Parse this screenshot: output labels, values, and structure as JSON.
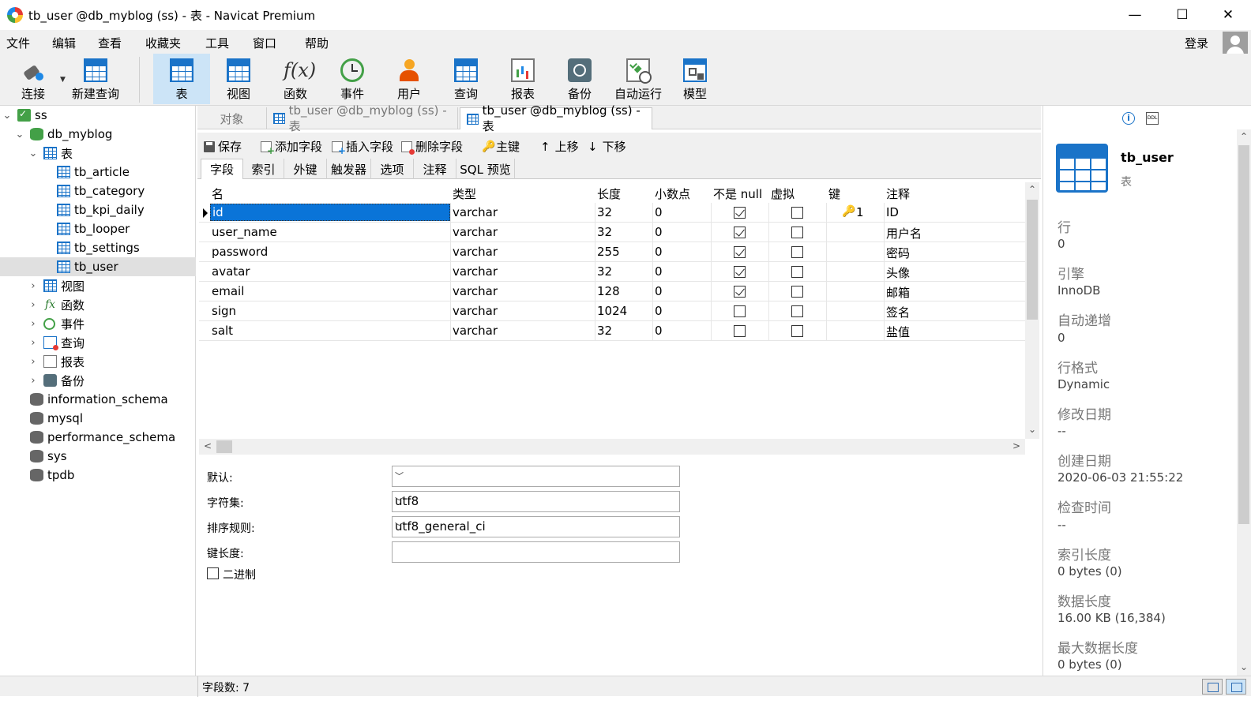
{
  "window": {
    "title": "tb_user @db_myblog (ss) - 表 - Navicat Premium",
    "minimize": "—",
    "maximize": "☐",
    "close": "✕"
  },
  "menu": [
    "文件",
    "编辑",
    "查看",
    "收藏夹",
    "工具",
    "窗口",
    "帮助"
  ],
  "login_label": "登录",
  "toolbar": {
    "connect": "连接",
    "new_query": "新建查询",
    "table": "表",
    "view": "视图",
    "function": "函数",
    "event": "事件",
    "user": "用户",
    "query": "查询",
    "report": "报表",
    "backup": "备份",
    "automation": "自动运行",
    "model": "模型",
    "fx_glyph": "f(x)"
  },
  "tree": {
    "connection": "ss",
    "database": "db_myblog",
    "tables_group": "表",
    "tables": [
      "tb_article",
      "tb_category",
      "tb_kpi_daily",
      "tb_looper",
      "tb_settings",
      "tb_user"
    ],
    "groups": [
      "视图",
      "函数",
      "事件",
      "查询",
      "报表",
      "备份"
    ],
    "other_dbs": [
      "information_schema",
      "mysql",
      "performance_schema",
      "sys",
      "tpdb"
    ],
    "fx_glyph": "fx"
  },
  "tabs": {
    "objects": "对象",
    "tab1": "tb_user @db_myblog (ss) - 表",
    "tab2": "tb_user @db_myblog (ss) - 表"
  },
  "field_toolbar": {
    "save": "保存",
    "add_field": "添加字段",
    "insert_field": "插入字段",
    "delete_field": "删除字段",
    "primary_key": "主键",
    "move_up": "上移",
    "move_down": "下移",
    "up_arrow": "↑",
    "down_arrow": "↓",
    "key_glyph": "🔑"
  },
  "subtabs": [
    "字段",
    "索引",
    "外键",
    "触发器",
    "选项",
    "注释",
    "SQL 预览"
  ],
  "grid": {
    "headers": [
      "名",
      "类型",
      "长度",
      "小数点",
      "不是 null",
      "虚拟",
      "键",
      "注释"
    ],
    "rows": [
      {
        "name": "id",
        "type": "varchar",
        "length": "32",
        "decimals": "0",
        "not_null": true,
        "virtual": false,
        "key": "1",
        "comment": "ID"
      },
      {
        "name": "user_name",
        "type": "varchar",
        "length": "32",
        "decimals": "0",
        "not_null": true,
        "virtual": false,
        "key": "",
        "comment": "用户名"
      },
      {
        "name": "password",
        "type": "varchar",
        "length": "255",
        "decimals": "0",
        "not_null": true,
        "virtual": false,
        "key": "",
        "comment": "密码"
      },
      {
        "name": "avatar",
        "type": "varchar",
        "length": "32",
        "decimals": "0",
        "not_null": true,
        "virtual": false,
        "key": "",
        "comment": "头像"
      },
      {
        "name": "email",
        "type": "varchar",
        "length": "128",
        "decimals": "0",
        "not_null": true,
        "virtual": false,
        "key": "",
        "comment": "邮箱"
      },
      {
        "name": "sign",
        "type": "varchar",
        "length": "1024",
        "decimals": "0",
        "not_null": false,
        "virtual": false,
        "key": "",
        "comment": "签名"
      },
      {
        "name": "salt",
        "type": "varchar",
        "length": "32",
        "decimals": "0",
        "not_null": false,
        "virtual": false,
        "key": "",
        "comment": "盐值"
      }
    ],
    "key_glyph": "🔑"
  },
  "scroll": {
    "up": "⌃",
    "down": "⌄",
    "left": "<",
    "right": ">"
  },
  "props": {
    "default_label": "默认:",
    "default_value": "",
    "charset_label": "字符集:",
    "charset_value": "utf8",
    "collation_label": "排序规则:",
    "collation_value": "utf8_general_ci",
    "key_length_label": "键长度:",
    "key_length_value": "",
    "binary_label": "二进制",
    "caret": "﹀"
  },
  "status": {
    "field_count": "字段数: 7"
  },
  "info": {
    "info_glyph": "i",
    "ddl_glyph": "DDL",
    "name": "tb_user",
    "type": "表",
    "items": [
      {
        "label": "行",
        "value": "0"
      },
      {
        "label": "引擎",
        "value": "InnoDB"
      },
      {
        "label": "自动递增",
        "value": "0"
      },
      {
        "label": "行格式",
        "value": "Dynamic"
      },
      {
        "label": "修改日期",
        "value": "--"
      },
      {
        "label": "创建日期",
        "value": "2020-06-03 21:55:22"
      },
      {
        "label": "检查时间",
        "value": "--"
      },
      {
        "label": "索引长度",
        "value": "0 bytes (0)"
      },
      {
        "label": "数据长度",
        "value": "16.00 KB (16,384)"
      },
      {
        "label": "最大数据长度",
        "value": "0 bytes (0)"
      }
    ]
  }
}
